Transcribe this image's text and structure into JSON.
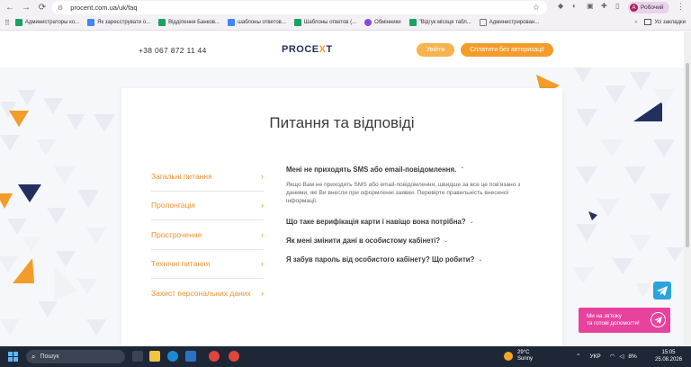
{
  "browser": {
    "url": "procent.com.ua/uk/faq",
    "profile_initial": "A",
    "profile_label": "Робочий",
    "bookmarks": [
      {
        "label": "Администраторы ко...",
        "color": "#1aa260"
      },
      {
        "label": "Як зареєструвати о...",
        "color": "#4285f4"
      },
      {
        "label": "Відділення Банков...",
        "color": "#1aa260"
      },
      {
        "label": "шаблоны ответов...",
        "color": "#4285f4"
      },
      {
        "label": "Шаблоны ответов (...",
        "color": "#1aa260"
      },
      {
        "label": "Обмінники",
        "color": "#8a4ad8"
      },
      {
        "label": "\"Відгук місяця табл...",
        "color": "#1aa260"
      },
      {
        "label": "Администрирован...",
        "color": "#777777"
      }
    ],
    "all_bookmarks": "Усі закладки"
  },
  "header": {
    "phone": "+38 067 872 11 44",
    "logo_main": "PROCE",
    "logo_accent": "X",
    "logo_end": "T",
    "login_label": "Увійти",
    "pay_label": "Сплатити без авторизації"
  },
  "faq": {
    "title": "Питання та відповіді",
    "categories": [
      {
        "label": "Загальні питання"
      },
      {
        "label": "Пролонгація"
      },
      {
        "label": "Прострочення"
      },
      {
        "label": "Технічні питання"
      },
      {
        "label": "Захист персональних даних"
      }
    ],
    "questions": [
      {
        "question": "Мені не приходять SMS або email-повідомлення.",
        "expanded": true,
        "answer": "Якщо Вам не приходять SMS або email-повідомлення, швидше за все це пов'язано з даними, які Ви внесли при оформленні заявки. Перевірте правильність внесеної інформації."
      },
      {
        "question": "Що таке верифікація карти і навіщо вона потрібна?",
        "expanded": false
      },
      {
        "question": "Як мені змінити дані в особистому кабінеті?",
        "expanded": false
      },
      {
        "question": "Я забув пароль від особистого кабінету? Що робити?",
        "expanded": false
      }
    ]
  },
  "telegram": {
    "promo_line1": "Ми на зв'язку",
    "promo_line2": "та готові допомогти!"
  },
  "taskbar": {
    "search_placeholder": "Пошук",
    "temperature": "29°C",
    "weather": "Sunny",
    "language": "УКР",
    "battery": "8%",
    "time": "15:05",
    "date": "25.08.2026"
  },
  "colors": {
    "orange": "#f0912c",
    "navy": "#23305e",
    "telegram": "#2ba3df",
    "promo_pink": "#e6429e"
  }
}
